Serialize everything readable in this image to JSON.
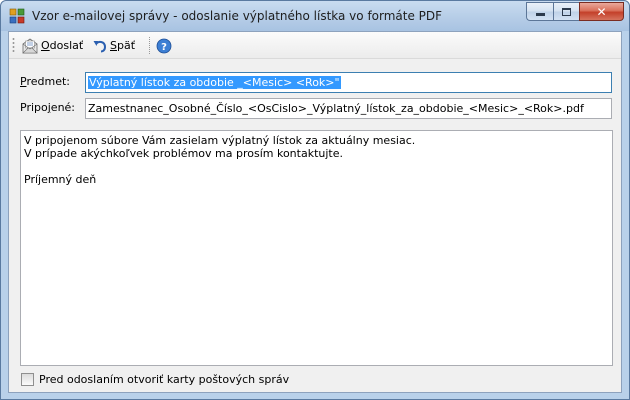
{
  "window": {
    "title": "Vzor e-mailovej správy - odoslanie výplatného lístka vo formáte PDF",
    "close_glyph": "✕"
  },
  "toolbar": {
    "send_label": "Odoslať",
    "send_mnemonic": "O",
    "send_rest": "doslať",
    "back_label": "Späť",
    "back_mnemonic": "S",
    "back_rest": "päť",
    "help_icon": "help-icon"
  },
  "form": {
    "subject_label": "Predmet:",
    "subject_label_mnemonic": "P",
    "subject_label_rest": "redmet:",
    "subject_value": "Výplatný lístok za obdobie _<Mesic> <Rok>\"",
    "attachment_label": "Pripojené:",
    "attachment_label_a": "Pripo",
    "attachment_label_mnemonic": "j",
    "attachment_label_b": "ené:",
    "attachment_value": "Zamestnanec_Osobné_Číslo_<OsCislo>_Výplatný_lístok_za_obdobie_<Mesic>_<Rok>.pdf",
    "body_text": "V pripojenom súbore Vám zasielam výplatný lístok za aktuálny mesiac.\nV prípade akýchkoľvek problémov ma prosím kontaktujte.\n\nPríjemný deň",
    "open_mail_label": "Pred odoslaním otvoriť karty poštových správ",
    "open_mail_checked": false
  },
  "colors": {
    "selection": "#3399ff",
    "window_frame": "#b9d1ea",
    "client_bg": "#f0f0f0"
  }
}
